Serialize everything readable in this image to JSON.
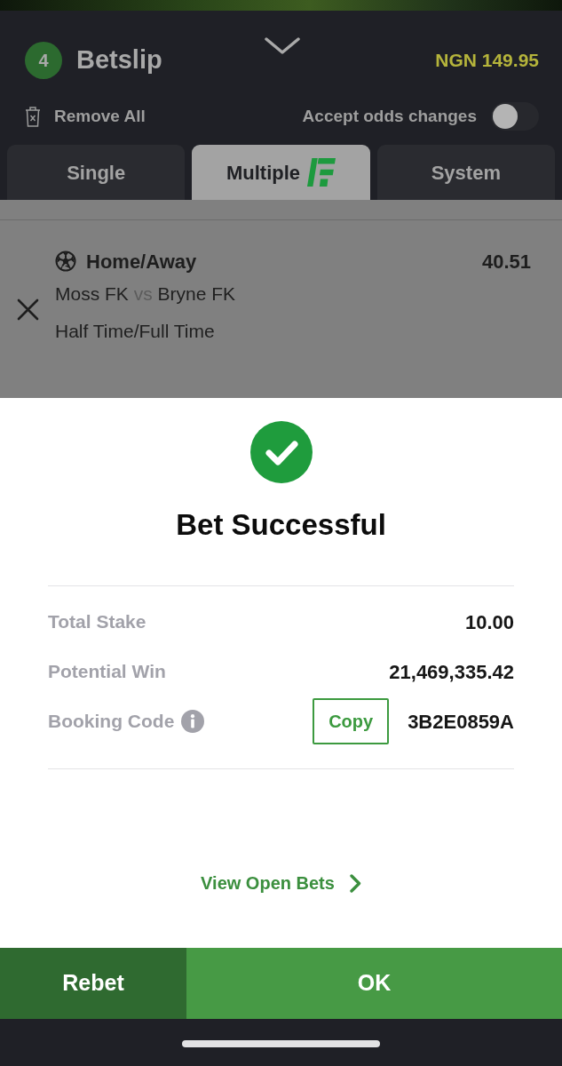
{
  "header": {
    "count": "4",
    "title": "Betslip",
    "balance": "NGN 149.95"
  },
  "actions": {
    "remove_all": "Remove All",
    "accept_odds": {
      "label": "Accept odds changes",
      "on": false
    }
  },
  "tabs": [
    {
      "label": "Single",
      "selected": false,
      "logo": false
    },
    {
      "label": "Multiple",
      "selected": true,
      "logo": true
    },
    {
      "label": "System",
      "selected": false,
      "logo": false
    }
  ],
  "selection": {
    "market": "Home/Away",
    "odds": "40.51",
    "home": "Moss FK",
    "separator": "vs",
    "away": "Bryne FK",
    "outcome": "Half Time/Full Time"
  },
  "result": {
    "title": "Bet Successful",
    "rows": [
      {
        "kind": "amount",
        "label": "Total Stake",
        "value": "10.00"
      },
      {
        "kind": "amount",
        "label": "Potential Win",
        "value": "21,469,335.42"
      },
      {
        "kind": "code",
        "label": "Booking Code",
        "button": "Copy",
        "value": "3B2E0859A"
      }
    ],
    "link": "View Open Bets"
  },
  "buttons": [
    {
      "kind": "secondary",
      "label": "Rebet"
    },
    {
      "kind": "primary",
      "label": "OK"
    }
  ]
}
